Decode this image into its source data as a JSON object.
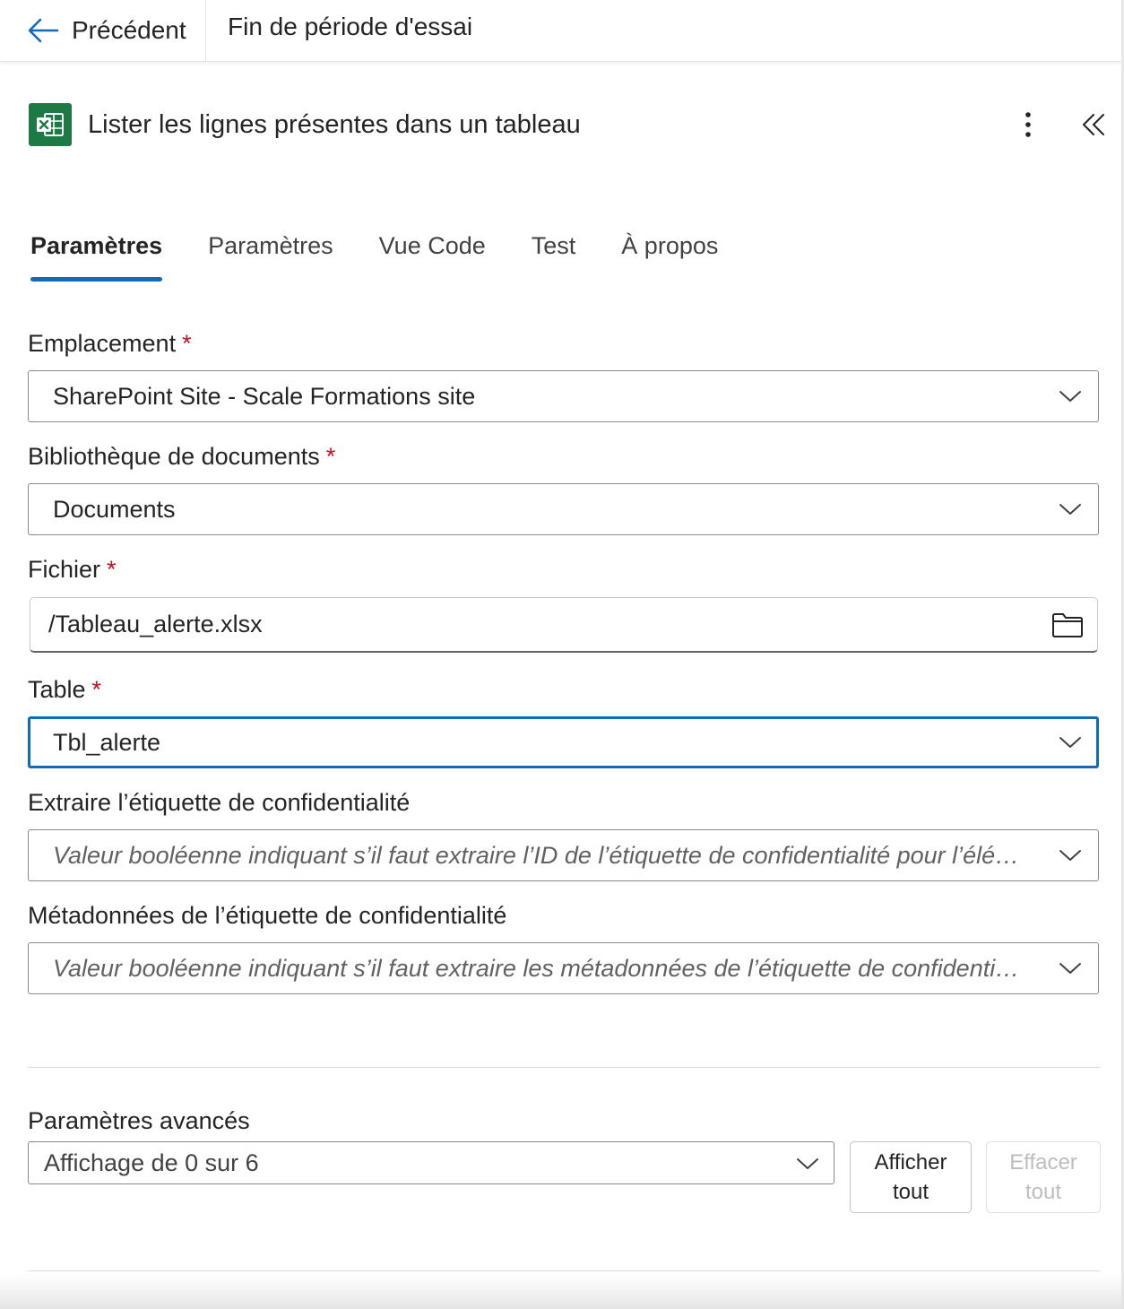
{
  "topbar": {
    "back_label": "Précédent",
    "trial_label": "Fin de période d'essai"
  },
  "action": {
    "title": "Lister les lignes présentes dans un tableau",
    "icon": "excel-icon",
    "brand_color": "#1d7a45"
  },
  "tabs": [
    {
      "label": "Paramètres",
      "active": true
    },
    {
      "label": "Paramètres",
      "active": false
    },
    {
      "label": "Vue Code",
      "active": false
    },
    {
      "label": "Test",
      "active": false
    },
    {
      "label": "À propos",
      "active": false
    }
  ],
  "fields": {
    "location": {
      "label": "Emplacement",
      "required_mark": "*",
      "value": "SharePoint Site - Scale Formations site"
    },
    "library": {
      "label": "Bibliothèque de documents",
      "required_mark": "*",
      "value": "Documents"
    },
    "file": {
      "label": "Fichier",
      "required_mark": "*",
      "value": "/Tableau_alerte.xlsx"
    },
    "table": {
      "label": "Table",
      "required_mark": "*",
      "value": "Tbl_alerte"
    },
    "extract_label": {
      "label": "Extraire l’étiquette de confidentialité",
      "placeholder": "Valeur booléenne indiquant s’il faut extraire l’ID de l’étiquette de confidentialité pour l’élément associé"
    },
    "label_metadata": {
      "label": "Métadonnées de l’étiquette de confidentialité",
      "placeholder": "Valeur booléenne indiquant s’il faut extraire les métadonnées de l’étiquette de confidentialité pour l’élément associé"
    }
  },
  "advanced": {
    "label": "Paramètres avancés",
    "select_value": "Affichage de 0 sur 6",
    "show_all_line1": "Afficher",
    "show_all_line2": "tout",
    "clear_all_line1": "Effacer",
    "clear_all_line2": "tout"
  },
  "colors": {
    "accent": "#0f6cbd",
    "required": "#c50f1f",
    "text": "#242424"
  }
}
